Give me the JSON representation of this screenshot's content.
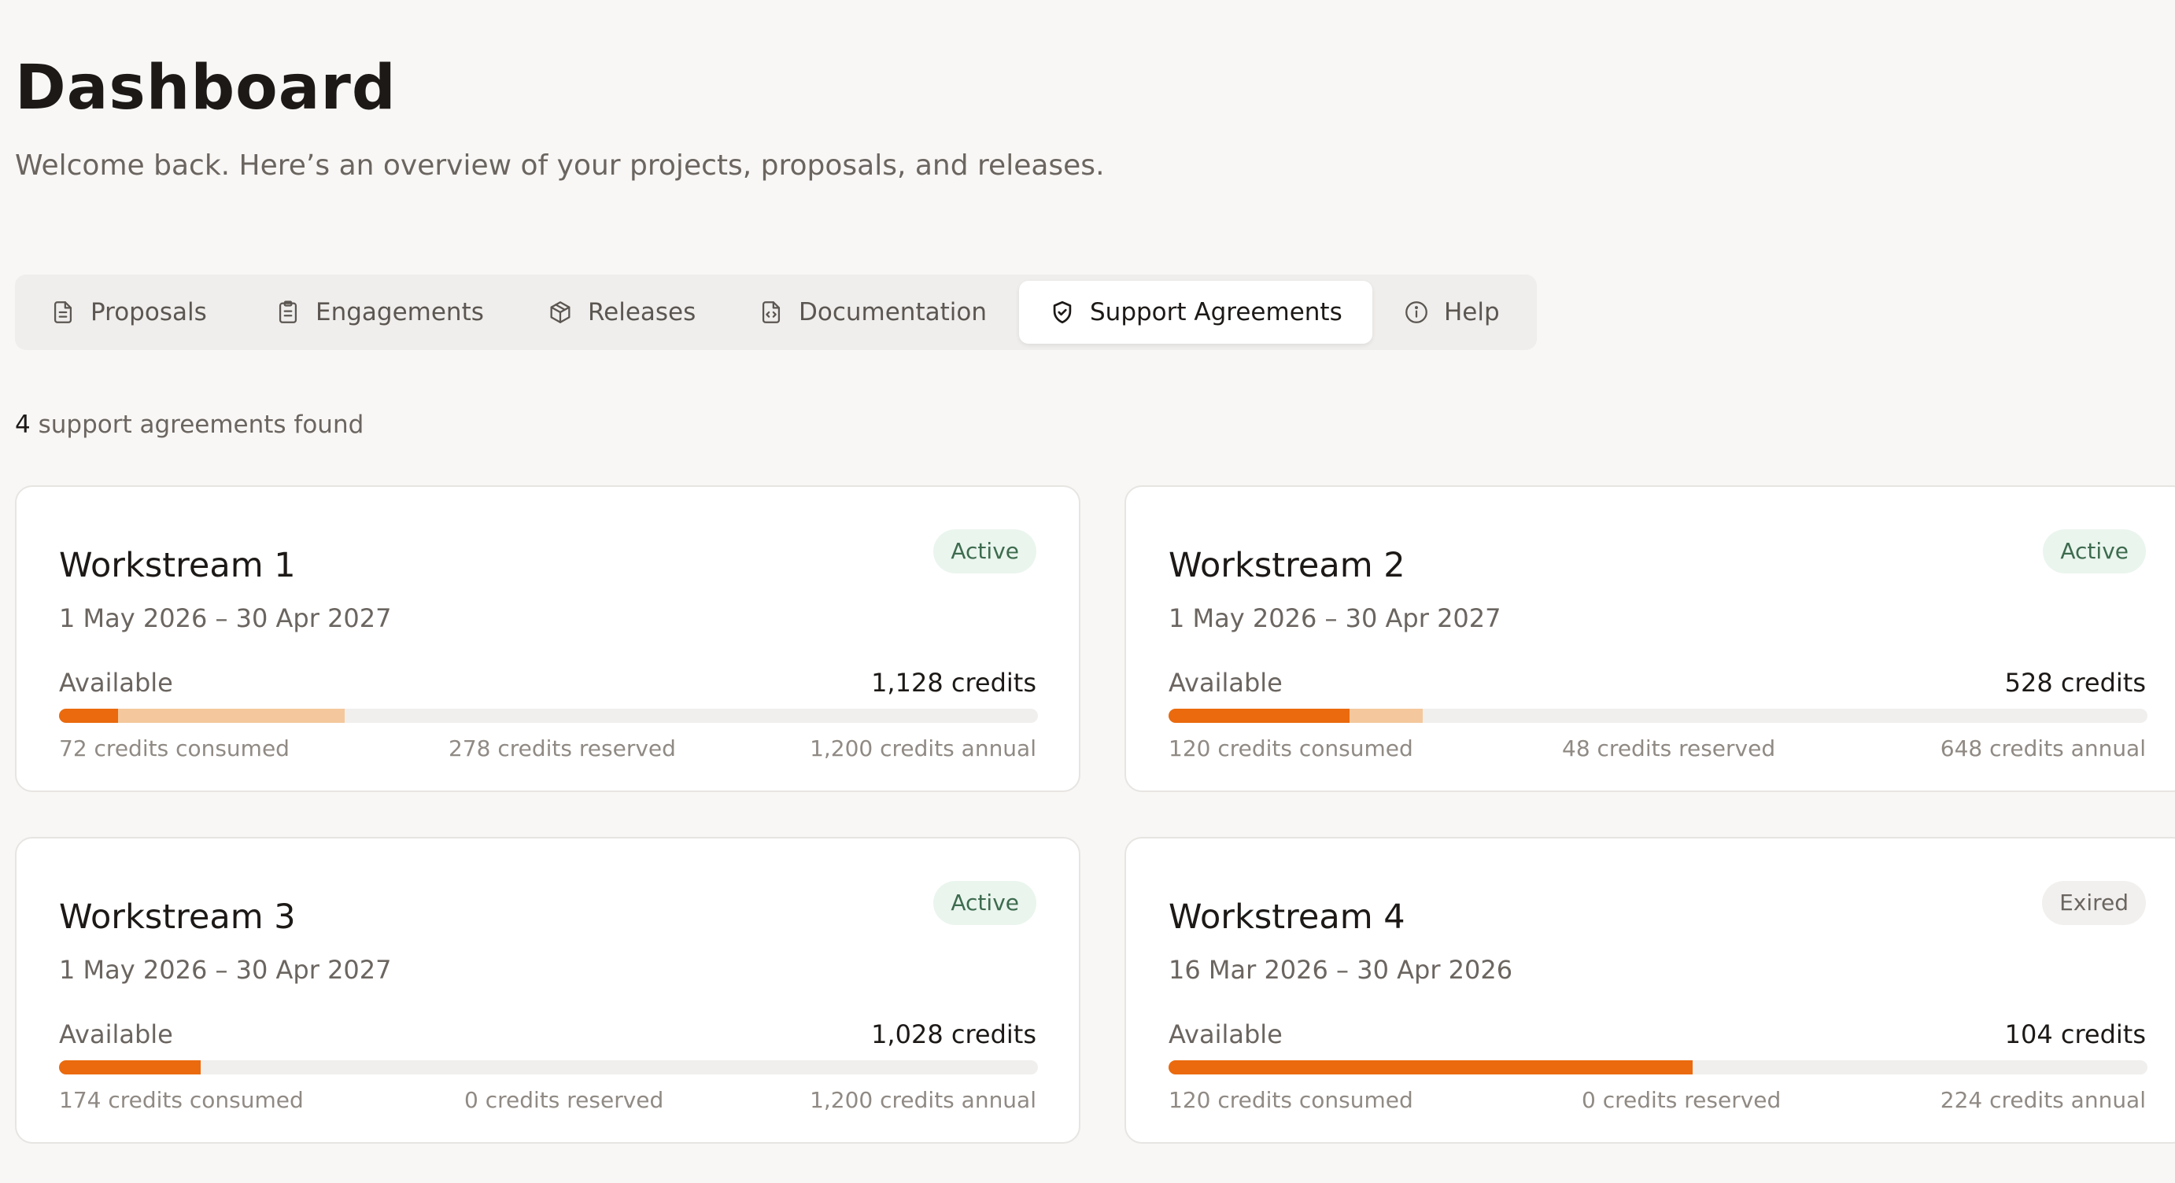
{
  "header": {
    "title": "Dashboard",
    "subtitle": "Welcome back. Here’s an overview of your projects, proposals, and releases."
  },
  "tabs": [
    {
      "label": "Proposals",
      "icon": "document-icon",
      "active": false
    },
    {
      "label": "Engagements",
      "icon": "clipboard-icon",
      "active": false
    },
    {
      "label": "Releases",
      "icon": "package-icon",
      "active": false
    },
    {
      "label": "Documentation",
      "icon": "file-code-icon",
      "active": false
    },
    {
      "label": "Support Agreements",
      "icon": "shield-check-icon",
      "active": true
    },
    {
      "label": "Help",
      "icon": "info-icon",
      "active": false
    }
  ],
  "results": {
    "count": "4",
    "label": "support agreements found"
  },
  "colors": {
    "consumed": "#ea6a0d",
    "reserved": "#f4c89c",
    "track": "#f0efed",
    "active_badge_bg": "#eaf5ee",
    "active_badge_text": "#3d6b4e",
    "expired_badge_bg": "#f1f0ee"
  },
  "agreements": [
    {
      "name": "Workstream 1",
      "dates": "1 May 2026 – 30 Apr 2027",
      "status": "Active",
      "available_label": "Available",
      "available": "1,128 credits",
      "consumed_text": "72 credits consumed",
      "reserved_text": "278 credits reserved",
      "annual_text": "1,200 credits annual",
      "consumed": 72,
      "reserved": 278,
      "annual": 1200
    },
    {
      "name": "Workstream 2",
      "dates": "1 May 2026 – 30 Apr 2027",
      "status": "Active",
      "available_label": "Available",
      "available": "528 credits",
      "consumed_text": "120 credits consumed",
      "reserved_text": "48 credits reserved",
      "annual_text": "648 credits annual",
      "consumed": 120,
      "reserved": 48,
      "annual": 648
    },
    {
      "name": "Workstream 3",
      "dates": "1 May 2026 – 30 Apr 2027",
      "status": "Active",
      "available_label": "Available",
      "available": "1,028 credits",
      "consumed_text": "174 credits consumed",
      "reserved_text": "0 credits reserved",
      "annual_text": "1,200 credits annual",
      "consumed": 174,
      "reserved": 0,
      "annual": 1200
    },
    {
      "name": "Workstream 4",
      "dates": "16 Mar 2026 – 30 Apr 2026",
      "status": "Exired",
      "available_label": "Available",
      "available": "104 credits",
      "consumed_text": "120 credits consumed",
      "reserved_text": "0 credits reserved",
      "annual_text": "224 credits annual",
      "consumed": 120,
      "reserved": 0,
      "annual": 224
    }
  ]
}
